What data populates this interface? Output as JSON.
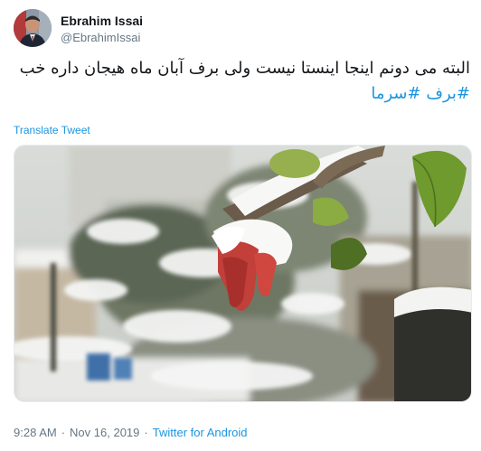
{
  "user": {
    "display_name": "Ebrahim Issai",
    "handle": "@EbrahimIssai"
  },
  "tweet": {
    "text_line1": "البته می دونم اینجا اینستا نیست ولی برف آبان ماه هیجان داره خب",
    "hashtags": [
      "#برف",
      "#سرما"
    ]
  },
  "translate_label": "Translate Tweet",
  "meta": {
    "time": "9:28 AM",
    "separator": "·",
    "date": "Nov 16, 2019",
    "source": "Twitter for Android"
  },
  "icons": {
    "avatar": "profile-photo",
    "media": "snowy-garden-photo"
  },
  "colors": {
    "link": "#1b95e0",
    "secondary_text": "#657786",
    "primary_text": "#14171a"
  }
}
